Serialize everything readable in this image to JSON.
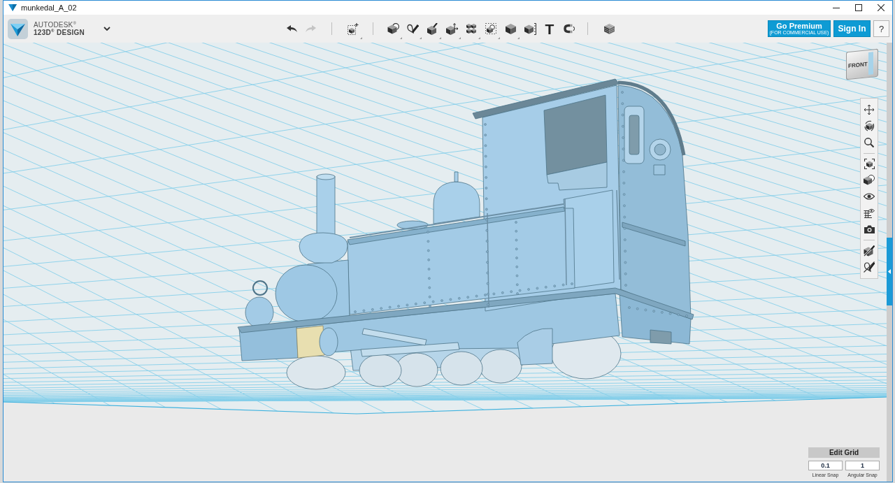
{
  "window": {
    "title": "munkedal_A_02"
  },
  "header": {
    "brand": "AUTODESK$^{®}$",
    "product": "123D$^{®}$ DESIGN"
  },
  "toolbar": {
    "undo": {
      "disabled": false
    },
    "redo": {
      "disabled": true
    },
    "text_tool": "T"
  },
  "account": {
    "premium": {
      "label": "Go Premium",
      "note": "(FOR COMMERCIAL USE)"
    },
    "sign_in": "Sign In",
    "help": "?"
  },
  "view_cube": {
    "face": "FRONT"
  },
  "grid_panel": {
    "button": "Edit Grid",
    "fields": [
      {
        "value": "0.1",
        "label": "Linear Snap"
      },
      {
        "value": "1",
        "label": "Angular Snap"
      }
    ]
  }
}
